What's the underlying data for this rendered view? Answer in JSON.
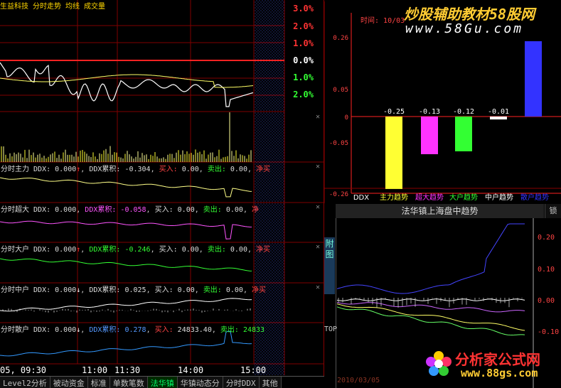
{
  "header": {
    "stock": "生益科技",
    "mode": "分时走势",
    "ma": "均线",
    "vol": "成交量"
  },
  "price_axis": [
    "3.0%",
    "2.0%",
    "1.0%",
    "0.0%",
    "1.0%",
    "2.0%"
  ],
  "panels": [
    {
      "name": "分时主力",
      "ddx": "DDX: 0.000",
      "ddx_arrow": "↑",
      "cum_label": "DDX累积:",
      "cum": "-0.304",
      "buy_label": "买入:",
      "buy": "0.00",
      "sell_label": "卖出:",
      "sell": "0.00",
      "net_label": "净买"
    },
    {
      "name": "分时超大",
      "ddx": "DDX: 0.000",
      "ddx_arrow": "",
      "cum_label": "DDX累积:",
      "cum": "-0.058",
      "buy_label": "买入:",
      "buy": "0.00",
      "sell_label": "卖出:",
      "sell": "0.00",
      "net_label": "净"
    },
    {
      "name": "分时大户",
      "ddx": "DDX: 0.000",
      "ddx_arrow": "↑",
      "cum_label": "DDX累积:",
      "cum": "-0.246",
      "buy_label": "买入:",
      "buy": "0.00",
      "sell_label": "卖出:",
      "sell": "0.00",
      "net_label": "净买"
    },
    {
      "name": "分时中户",
      "ddx": "DDX: 0.000",
      "ddx_arrow": "↓",
      "cum_label": "DDX累积:",
      "cum": "0.025",
      "buy_label": "买入:",
      "buy": "0.00",
      "sell_label": "卖出:",
      "sell": "0.00",
      "net_label": "净买"
    },
    {
      "name": "分时散户",
      "ddx": "DDX: 0.000",
      "ddx_arrow": "↓",
      "cum_label": "DDX累积:",
      "cum": "0.278",
      "buy_label": "买入:",
      "buy": "24833.40",
      "sell_label": "卖出:",
      "sell": "24833",
      "net_label": "◀"
    }
  ],
  "time_axis": [
    "05, 09:30",
    "11:00",
    "11:30",
    "14:00",
    "15:00"
  ],
  "tabs": [
    "Level2分析",
    "被动资金",
    "标准",
    "单数笔数",
    "法华镇",
    "华镇动态分",
    "分时DDX",
    "其他"
  ],
  "active_tab": "法华镇",
  "bar_chart": {
    "time_label": "时间",
    "date": "10/03",
    "yticks": [
      "0.26",
      "0.05",
      "0",
      "-0.05",
      "-0.26"
    ],
    "categories": [
      "DDX",
      "主力趋势",
      "超大趋势",
      "大户趋势",
      "中户趋势",
      "散户趋势"
    ],
    "values": [
      -0.25,
      -0.13,
      -0.12,
      -0.01,
      0.26
    ],
    "value_labels": [
      "-0.25",
      "-0.13",
      "-0.12",
      "-0.01"
    ],
    "colors": [
      "#ffff33",
      "#ff33ff",
      "#33ff33",
      "#ffffff",
      "#3333ff"
    ]
  },
  "trend": {
    "title": "法华镇上海盘中趋势",
    "lock": "锁",
    "yticks": [
      "0.20",
      "0.10",
      "0.00",
      "-0.10"
    ],
    "date": "2010/03/05",
    "side_tab": "附图",
    "top_tab": "TOP"
  },
  "watermarks": {
    "top_cn": "炒股辅助教材58股网",
    "top_url": "www.58Gu.com",
    "bot_cn": "分析家公式网",
    "bot_url": "www.88gs.com"
  },
  "colors": {
    "up": "#ff3333",
    "down": "#33ff33",
    "grid": "#800000",
    "accent": "#ffd700"
  }
}
